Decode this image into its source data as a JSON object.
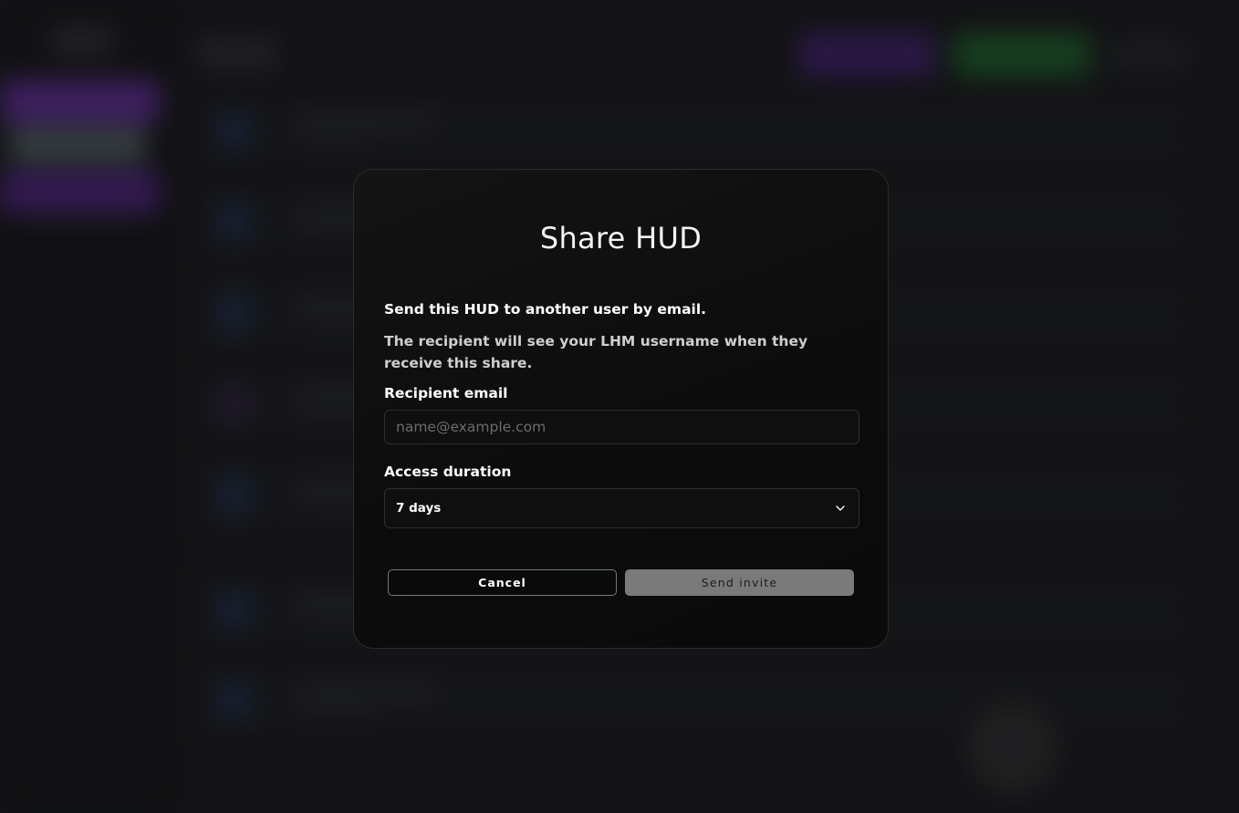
{
  "modal": {
    "title": "Share HUD",
    "intro": "Send this HUD to another user by email.",
    "note": "The recipient will see your LHM username when they receive this share.",
    "email": {
      "label": "Recipient email",
      "placeholder": "name@example.com",
      "value": ""
    },
    "duration": {
      "label": "Access duration",
      "selected": "7 days"
    },
    "buttons": {
      "cancel": "Cancel",
      "send": "Send invite"
    }
  },
  "colors": {
    "modal_bg": "#0c0c0d",
    "cancel_border": "#6c7a7c",
    "send_disabled_bg": "#7a7a7a"
  },
  "icons": {
    "dropdown": "chevron-down-icon"
  }
}
